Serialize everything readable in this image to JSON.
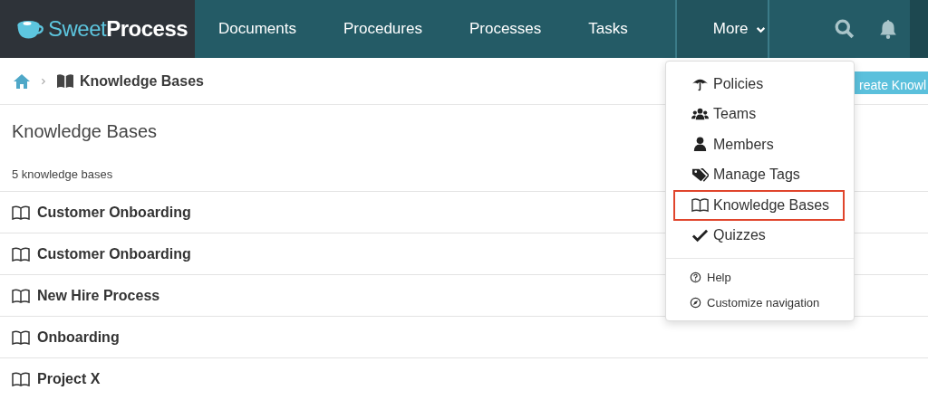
{
  "brand": {
    "light": "Sweet",
    "bold": "Process"
  },
  "nav": {
    "items": [
      {
        "label": "Documents"
      },
      {
        "label": "Procedures"
      },
      {
        "label": "Processes"
      },
      {
        "label": "Tasks"
      }
    ],
    "more": {
      "label": "More",
      "expanded": true
    }
  },
  "breadcrumb": {
    "current": "Knowledge Bases"
  },
  "create_button": {
    "label": "reate Knowl"
  },
  "page": {
    "title": "Knowledge Bases",
    "count": "5 knowledge bases",
    "rows": [
      "Customer Onboarding",
      "Customer Onboarding",
      "New Hire Process",
      "Onboarding",
      "Project X"
    ]
  },
  "menu": {
    "items": [
      {
        "kind": "umbrella",
        "label": "Policies",
        "selected": false
      },
      {
        "kind": "users",
        "label": "Teams",
        "selected": false
      },
      {
        "kind": "user",
        "label": "Members",
        "selected": false
      },
      {
        "kind": "tags",
        "label": "Manage Tags",
        "selected": false
      },
      {
        "kind": "book",
        "label": "Knowledge Bases",
        "selected": true
      },
      {
        "kind": "check",
        "label": "Quizzes",
        "selected": false
      }
    ],
    "secondary_items": [
      {
        "kind": "help",
        "label": "Help"
      },
      {
        "kind": "compass",
        "label": "Customize navigation"
      }
    ]
  }
}
